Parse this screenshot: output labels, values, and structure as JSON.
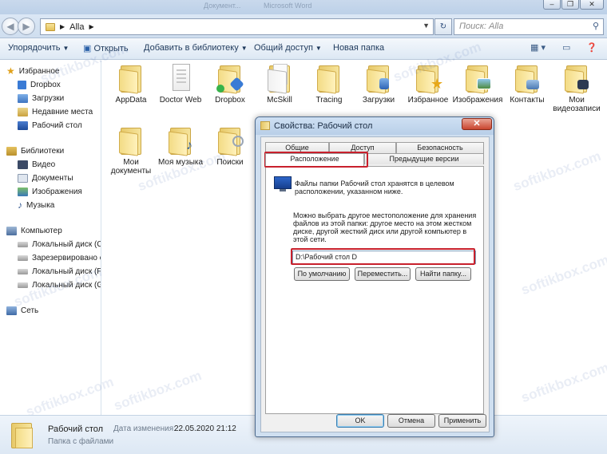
{
  "window": {
    "title_fragments": [
      "Документ...",
      "Microsoft Word"
    ],
    "controls": [
      "–",
      "❐",
      "✕"
    ]
  },
  "address": {
    "breadcrumb": [
      "Alla"
    ],
    "search_placeholder": "Поиск: Alla"
  },
  "toolbar": {
    "organize": "Упорядочить",
    "open": "Открыть",
    "add_to_library": "Добавить в библиотеку",
    "share": "Общий доступ",
    "new_folder": "Новая папка"
  },
  "nav": {
    "favorites": "Избранное",
    "favorites_items": [
      "Dropbox",
      "Загрузки",
      "Недавние места",
      "Рабочий стол"
    ],
    "libraries": "Библиотеки",
    "libraries_items": [
      "Видео",
      "Документы",
      "Изображения",
      "Музыка"
    ],
    "computer": "Компьютер",
    "computer_items": [
      "Локальный диск (C",
      "Зарезервировано с",
      "Локальный диск (F:",
      "Локальный диск (G"
    ],
    "network": "Сеть"
  },
  "files": [
    {
      "name": "AppData"
    },
    {
      "name": "Doctor Web"
    },
    {
      "name": "Dropbox"
    },
    {
      "name": "McSkill"
    },
    {
      "name": "Tracing"
    },
    {
      "name": "Загрузки"
    },
    {
      "name": "Избранное"
    },
    {
      "name": "Изображения"
    },
    {
      "name": "Контакты"
    },
    {
      "name": "Мои видеозаписи"
    },
    {
      "name": "Мои документы"
    },
    {
      "name": "Моя музыка"
    },
    {
      "name": "Поиски"
    }
  ],
  "watermark": "softikbox.com",
  "details": {
    "name": "Рабочий стол",
    "type": "Папка с файлами",
    "date_label": "Дата изменения:",
    "date_value": "22.05.2020 21:12"
  },
  "dialog": {
    "title": "Свойства: Рабочий стол",
    "close": "✕",
    "tabs": {
      "general": "Общие",
      "access": "Доступ",
      "security": "Безопасность",
      "location": "Расположение",
      "previous": "Предыдущие версии"
    },
    "text1": [
      "Файлы папки Рабочий стол хранятся в целевом",
      "расположении, указанном ниже."
    ],
    "text2": [
      "Можно выбрать другое местоположение для хранения",
      "файлов из этой папки: другое место на этом жестком",
      "диске, другой жесткий диск или другой компьютер в",
      "этой сети."
    ],
    "path_value": "D:\\Рабочий стол D",
    "btn_default": "По умолчанию",
    "btn_move": "Переместить...",
    "btn_find": "Найти папку...",
    "ok": "OK",
    "cancel": "Отмена",
    "apply": "Применить"
  },
  "colors": {
    "highlight": "#c8202c",
    "accent": "#3c7fb1"
  }
}
